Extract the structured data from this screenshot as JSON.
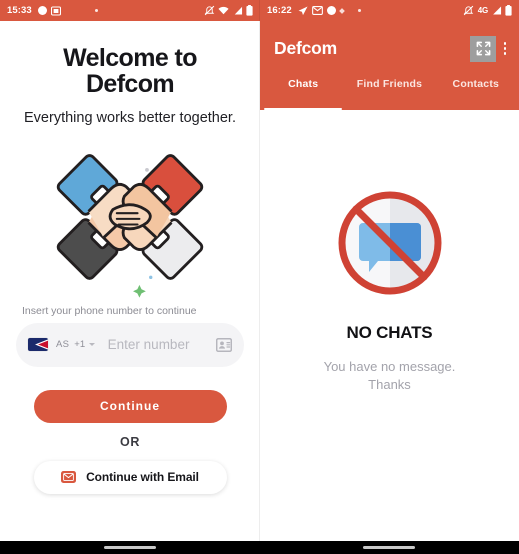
{
  "left_phone": {
    "status_bar": {
      "clock": "15:33",
      "icons_left": [
        "circle-dot-icon",
        "screenshot-icon",
        "small-dot-icon"
      ],
      "icons_right": [
        "mute-icon",
        "wifi-icon",
        "signal-icon",
        "battery-icon"
      ]
    },
    "welcome": {
      "title": "Welcome to Defcom",
      "subtitle": "Everything works better together.",
      "illustration": "teamwork-hands-icon",
      "field_label": "Insert your phone number to continue",
      "country_flag": "american-samoa-flag-icon",
      "country_code_label": "AS",
      "dial_code": "+1",
      "number_placeholder": "Enter number",
      "number_value": "",
      "contacts_icon": "contact-card-icon",
      "continue_label": "Continue",
      "or_label": "OR",
      "email_label": "Continue with Email",
      "email_icon": "envelope-icon"
    }
  },
  "right_phone": {
    "status_bar": {
      "clock": "16:22",
      "icons_left": [
        "send-icon",
        "mail-icon",
        "circle-dot-icon",
        "diamond-icon",
        "small-dot-icon"
      ],
      "icons_right": [
        "mute-icon",
        "signal-icon",
        "battery-icon"
      ],
      "network_label": "4G"
    },
    "appbar": {
      "title": "Defcom",
      "fullscreen_icon": "fullscreen-expand-icon",
      "overflow_icon": "more-vertical-icon",
      "tabs": [
        {
          "label": "Chats",
          "active": true
        },
        {
          "label": "Find Friends",
          "active": false
        },
        {
          "label": "Contacts",
          "active": false
        }
      ]
    },
    "empty_state": {
      "icon": "no-chats-prohibited-icon",
      "title": "NO CHATS",
      "line1": "You have no message.",
      "line2": "Thanks"
    }
  },
  "colors": {
    "brand_red": "#d9583f",
    "accent_blue": "#5fa8d8",
    "dark_gray": "#4d4d4d",
    "text_dark": "#16161a",
    "text_muted": "#a3a3ab"
  }
}
